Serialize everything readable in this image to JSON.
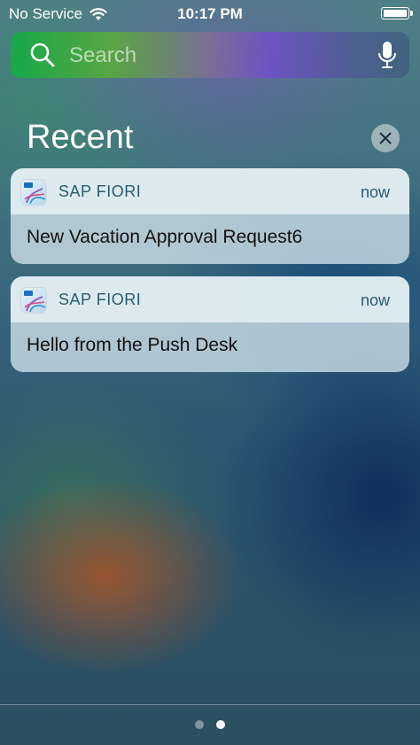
{
  "status_bar": {
    "carrier": "No Service",
    "time": "10:17 PM",
    "wifi_icon": "wifi-icon",
    "battery_icon": "battery-icon"
  },
  "search": {
    "placeholder": "Search",
    "icon": "search-icon",
    "mic_icon": "microphone-icon"
  },
  "recent": {
    "title": "Recent",
    "clear_icon": "close-icon"
  },
  "notifications": [
    {
      "app": "SAP FIORI",
      "time": "now",
      "message": "New Vacation Approval Request6",
      "icon": "sap-fiori-app-icon"
    },
    {
      "app": "SAP FIORI",
      "time": "now",
      "message": "Hello from the Push Desk",
      "icon": "sap-fiori-app-icon"
    }
  ],
  "page_indicator": {
    "pages": 2,
    "current": 2
  }
}
